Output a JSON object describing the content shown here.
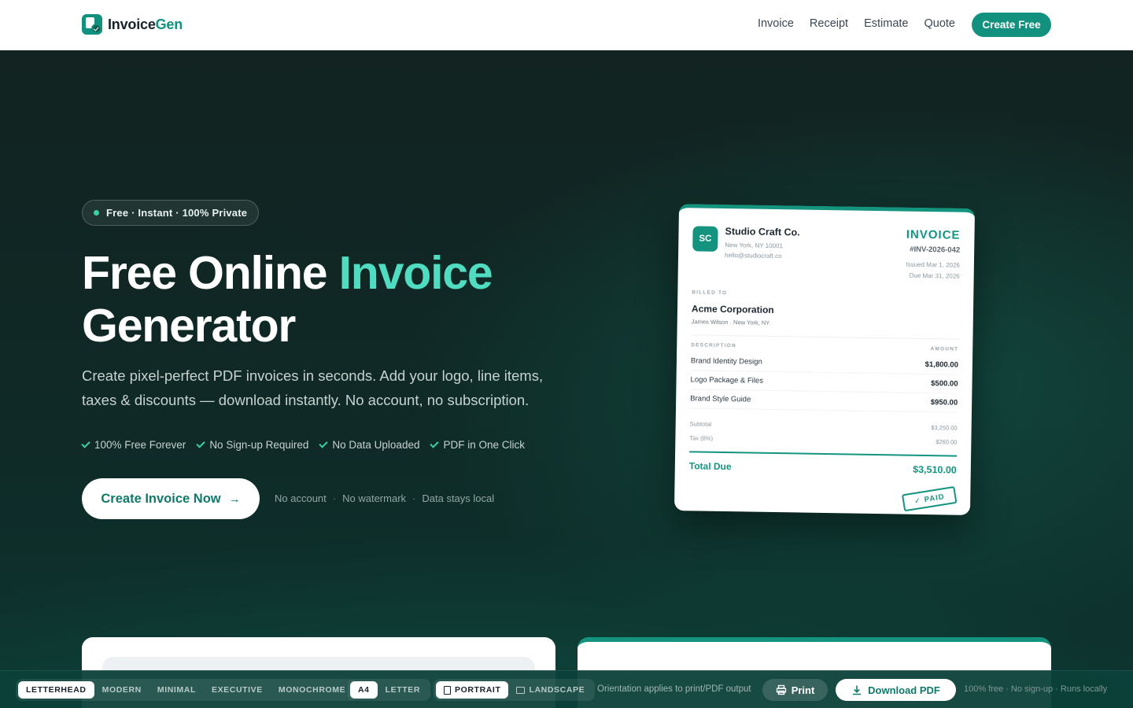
{
  "brand": {
    "name_main": "Invoice",
    "name_accent": "Gen",
    "accent_color": "#11917e"
  },
  "nav": {
    "links": [
      "Invoice",
      "Receipt",
      "Estimate",
      "Quote"
    ],
    "cta": "Create Free"
  },
  "hero": {
    "badge": "Free · Instant · 100% Private",
    "title_part1": "Free Online ",
    "title_highlight": "Invoice",
    "title_part2": "Generator",
    "subtitle": "Create pixel-perfect PDF invoices in seconds. Add your logo, line items, taxes & discounts — download instantly. No account, no subscription.",
    "checks": [
      "100% Free Forever",
      "No Sign-up Required",
      "No Data Uploaded",
      "PDF in One Click"
    ],
    "cta": "Create Invoice Now",
    "notes": [
      "No account",
      "No watermark",
      "Data stays local"
    ],
    "note_separator": "·"
  },
  "invoice_preview": {
    "logo_initials": "SC",
    "company": "Studio Craft Co.",
    "address": "New York, NY 10001",
    "email": "hello@studiocraft.co",
    "doc_title": "INVOICE",
    "number": "#INV-2026-042",
    "issued": "Issued Mar 1, 2026",
    "due": "Due Mar 31, 2026",
    "billed_to_label": "BILLED TO",
    "client": "Acme Corporation",
    "client_detail": "James Wilson · New York, NY",
    "col_description": "DESCRIPTION",
    "col_amount": "AMOUNT",
    "items": [
      {
        "desc": "Brand Identity Design",
        "amount": "$1,800.00"
      },
      {
        "desc": "Logo Package & Files",
        "amount": "$500.00"
      },
      {
        "desc": "Brand Style Guide",
        "amount": "$950.00"
      }
    ],
    "subtotal_label": "Subtotal",
    "subtotal": "$3,250.00",
    "tax_label": "Tax (8%)",
    "tax": "$260.00",
    "total_label": "Total Due",
    "total": "$3,510.00",
    "stamp": "PAID"
  },
  "toolbar": {
    "templates": [
      "LETTERHEAD",
      "MODERN",
      "MINIMAL",
      "EXECUTIVE",
      "MONOCHROME"
    ],
    "templates_selected": "LETTERHEAD",
    "sizes": [
      "A4",
      "LETTER"
    ],
    "size_selected": "A4",
    "orientations": [
      "PORTRAIT",
      "LANDSCAPE"
    ],
    "orientation_selected": "PORTRAIT",
    "orientation_note": "Orientation applies to print/PDF output",
    "print": "Print",
    "download": "Download PDF",
    "footer_note": "100% free · No sign-up · Runs locally"
  }
}
